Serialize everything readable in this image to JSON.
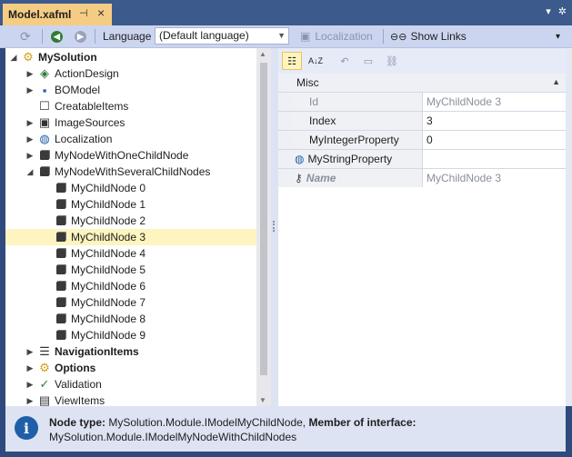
{
  "window": {
    "tab_title": "Model.xafml",
    "pin_icon": "pin-icon",
    "close_icon": "close-icon"
  },
  "toolbar": {
    "language_label": "Language",
    "language_value": "(Default language)",
    "localization_label": "Localization",
    "show_links_label": "Show Links"
  },
  "tree": {
    "items": [
      {
        "label": "MySolution",
        "bold": true,
        "icon": "gear-icon",
        "expanded": true
      },
      {
        "label": "ActionDesign",
        "icon": "action-design-icon"
      },
      {
        "label": "BOModel",
        "icon": "bo-model-icon"
      },
      {
        "label": "CreatableItems",
        "icon": "creatable-items-icon"
      },
      {
        "label": "ImageSources",
        "icon": "image-sources-icon"
      },
      {
        "label": "Localization",
        "icon": "globe-icon"
      },
      {
        "label": "MyNodeWithOneChildNode",
        "icon": "cube-icon"
      },
      {
        "label": "MyNodeWithSeveralChildNodes",
        "icon": "cube-icon",
        "expanded": true
      },
      {
        "label": "MyChildNode 0",
        "icon": "cube-icon"
      },
      {
        "label": "MyChildNode 1",
        "icon": "cube-icon"
      },
      {
        "label": "MyChildNode 2",
        "icon": "cube-icon"
      },
      {
        "label": "MyChildNode 3",
        "icon": "cube-icon",
        "selected": true
      },
      {
        "label": "MyChildNode 4",
        "icon": "cube-icon"
      },
      {
        "label": "MyChildNode 5",
        "icon": "cube-icon"
      },
      {
        "label": "MyChildNode 6",
        "icon": "cube-icon"
      },
      {
        "label": "MyChildNode 7",
        "icon": "cube-icon"
      },
      {
        "label": "MyChildNode 8",
        "icon": "cube-icon"
      },
      {
        "label": "MyChildNode 9",
        "icon": "cube-icon"
      },
      {
        "label": "NavigationItems",
        "bold": true,
        "icon": "navigation-icon"
      },
      {
        "label": "Options",
        "bold": true,
        "icon": "gear-icon"
      },
      {
        "label": "Validation",
        "icon": "checkmark-icon"
      },
      {
        "label": "ViewItems",
        "icon": "view-items-icon"
      }
    ]
  },
  "property_grid": {
    "category": "Misc",
    "rows": [
      {
        "name": "Id",
        "value": "MyChildNode 3",
        "readonly": true
      },
      {
        "name": "Index",
        "value": "3"
      },
      {
        "name": "MyIntegerProperty",
        "value": "0"
      },
      {
        "name": "MyStringProperty",
        "value": "",
        "icon": "globe-icon"
      },
      {
        "name": "Name",
        "value": "MyChildNode 3",
        "icon": "key-icon",
        "readonly": true
      }
    ]
  },
  "status": {
    "node_type_label": "Node type:",
    "node_type_value": "MySolution.Module.IModelMyChildNode,",
    "member_label": "Member of interface:",
    "member_value": "MySolution.Module.IModelMyNodeWithChildNodes"
  },
  "colors": {
    "accent": "#f5cc84",
    "selection": "#fdf4bf",
    "info": "#1f5fa8"
  }
}
